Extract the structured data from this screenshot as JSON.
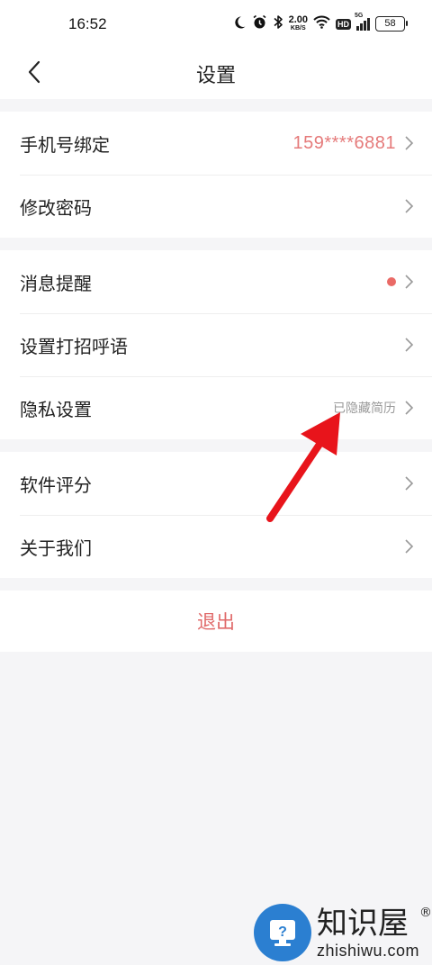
{
  "status_bar": {
    "time": "16:52",
    "net_speed_value": "2.00",
    "net_speed_unit": "KB/S",
    "hd_label": "HD",
    "signal_label": "5G",
    "battery": "58",
    "icons": [
      "moon-icon",
      "alarm-icon",
      "bluetooth-icon",
      "wifi-icon",
      "signal-icon",
      "battery-icon"
    ]
  },
  "nav": {
    "title": "设置",
    "back_icon": "chevron-left-icon"
  },
  "groups": [
    {
      "items": [
        {
          "label": "手机号绑定",
          "value": "159****6881"
        },
        {
          "label": "修改密码"
        }
      ]
    },
    {
      "items": [
        {
          "label": "消息提醒",
          "badge": "red-dot"
        },
        {
          "label": "设置打招呼语"
        },
        {
          "label": "隐私设置",
          "value": "已隐藏简历"
        }
      ]
    },
    {
      "items": [
        {
          "label": "软件评分"
        },
        {
          "label": "关于我们"
        }
      ]
    }
  ],
  "logout": {
    "label": "退出"
  },
  "watermark": {
    "name": "知识屋",
    "domain": "zhishiwu.com",
    "registered": "®"
  },
  "colors": {
    "accent_red": "#e06a6a",
    "phone_value": "#e57a7a",
    "dot": "#ea6a66",
    "annotation_arrow": "#e8141b",
    "watermark_blue": "#2b7fd1"
  }
}
